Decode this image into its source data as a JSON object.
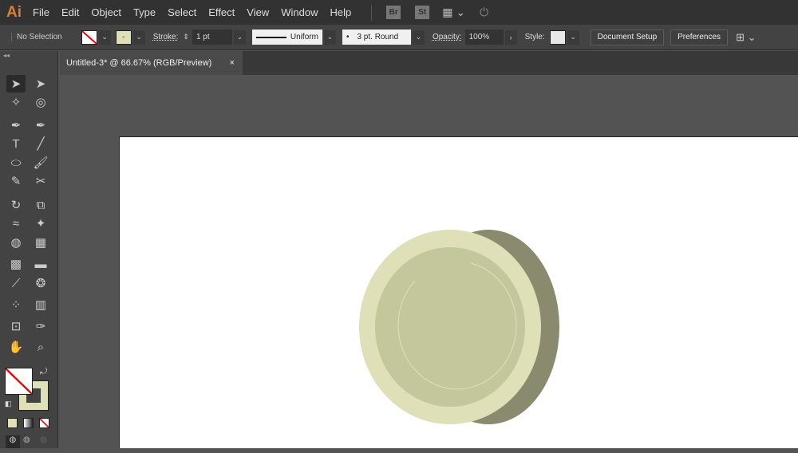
{
  "app": {
    "logo": "Ai"
  },
  "menu": [
    "File",
    "Edit",
    "Object",
    "Type",
    "Select",
    "Effect",
    "View",
    "Window",
    "Help"
  ],
  "menu_icons": {
    "bridge": "Br",
    "stock": "St",
    "workspace": "workspace-icon",
    "sync": "sync-icon"
  },
  "control": {
    "selection": "No Selection",
    "stroke_label": "Stroke:",
    "stroke_value": "1 pt",
    "profile": "Uniform",
    "brush": "3 pt. Round",
    "opacity_label": "Opacity:",
    "opacity_value": "100%",
    "style_label": "Style:",
    "document_setup": "Document Setup",
    "preferences": "Preferences",
    "fill_color": "#dfe0b8"
  },
  "document": {
    "tab_title": "Untitled-3* @ 66.67% (RGB/Preview)",
    "close": "×"
  },
  "tools": [
    {
      "name": "selection-tool",
      "g": "➤"
    },
    {
      "name": "direct-selection-tool",
      "g": "➤"
    },
    {
      "name": "magic-wand-tool",
      "g": "✧"
    },
    {
      "name": "lasso-tool",
      "g": "◎"
    },
    {
      "name": "pen-tool",
      "g": "✒"
    },
    {
      "name": "curvature-tool",
      "g": "✒"
    },
    {
      "name": "type-tool",
      "g": "T"
    },
    {
      "name": "line-tool",
      "g": "╱"
    },
    {
      "name": "ellipse-tool",
      "g": "⬭"
    },
    {
      "name": "paintbrush-tool",
      "g": "🖌"
    },
    {
      "name": "shaper-tool",
      "g": "✎"
    },
    {
      "name": "scissors-tool",
      "g": "✂"
    },
    {
      "name": "rotate-tool",
      "g": "↻"
    },
    {
      "name": "scale-tool",
      "g": "⧉"
    },
    {
      "name": "warp-tool",
      "g": "≈"
    },
    {
      "name": "puppet-warp-tool",
      "g": "✦"
    },
    {
      "name": "shape-builder-tool",
      "g": "◍"
    },
    {
      "name": "perspective-grid-tool",
      "g": "▦"
    },
    {
      "name": "mesh-tool",
      "g": "▩"
    },
    {
      "name": "gradient-tool",
      "g": "▬"
    },
    {
      "name": "eyedropper-tool",
      "g": "⟋"
    },
    {
      "name": "blend-tool",
      "g": "❂"
    },
    {
      "name": "symbol-sprayer-tool",
      "g": "⁘"
    },
    {
      "name": "column-graph-tool",
      "g": "▥"
    },
    {
      "name": "artboard-tool",
      "g": "⊡"
    },
    {
      "name": "slice-tool",
      "g": "✑"
    },
    {
      "name": "hand-tool",
      "g": "✋"
    },
    {
      "name": "zoom-tool",
      "g": "⌕"
    }
  ],
  "colors": {
    "fill": "none",
    "stroke": "#dfe0b8",
    "coin_face": "#dfe0b8",
    "coin_inner": "#c4c69c",
    "coin_edge": "#8a8a6e"
  }
}
